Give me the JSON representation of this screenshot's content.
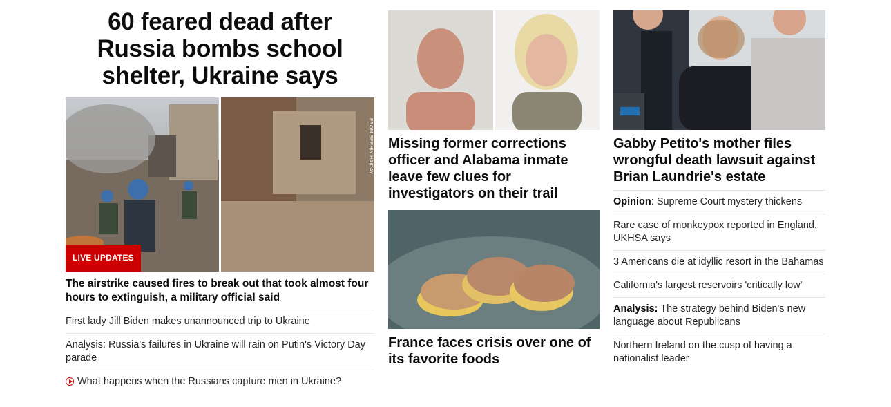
{
  "lead": {
    "headline": "60 feared dead after Russia bombs school shelter, Ukraine says",
    "badge": "LIVE UPDATES",
    "photo_credit": "FROM SERHIY HAIDAY",
    "caption": "The airstrike caused fires to break out that took almost four hours to extinguish, a military official said",
    "links": [
      {
        "text": "First lady Jill Biden makes unannounced trip to Ukraine"
      },
      {
        "text": "Analysis: Russia's failures in Ukraine will rain on Putin's Victory Day parade"
      },
      {
        "text": "What happens when the Russians capture men in Ukraine?",
        "icon": "play-icon"
      }
    ]
  },
  "middle": {
    "story1": {
      "headline": "Missing former corrections officer and Alabama inmate leave few clues for investigators on their trail"
    },
    "story2": {
      "headline": "France faces crisis over one of its favorite foods"
    }
  },
  "right": {
    "story": {
      "headline": "Gabby Petito's mother files wrongful death lawsuit against Brian Laundrie's estate"
    },
    "links": [
      {
        "prefix": "Opinion",
        "text": ": Supreme Court mystery thickens"
      },
      {
        "prefix": "",
        "text": "Rare case of monkeypox reported in England, UKHSA says"
      },
      {
        "prefix": "",
        "text": "3 Americans die at idyllic resort in the Bahamas"
      },
      {
        "prefix": "",
        "text": "California's largest reservoirs 'critically low'"
      },
      {
        "prefix": "Analysis:",
        "text": " The strategy behind Biden's new language about Republicans"
      },
      {
        "prefix": "",
        "text": "Northern Ireland on the cusp of having a nationalist leader"
      }
    ]
  },
  "colors": {
    "accent": "#cc0000",
    "text": "#0c0c0c",
    "divider": "#e6e6e6"
  }
}
